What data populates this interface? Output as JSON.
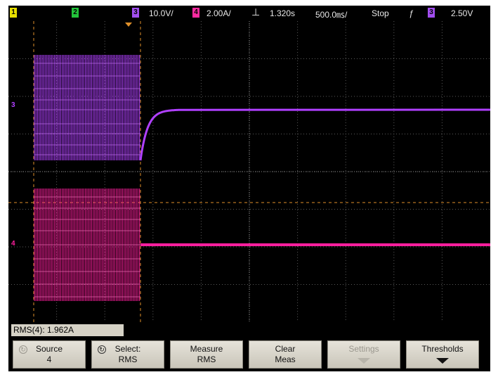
{
  "status_bar": {
    "channels": [
      {
        "number": "1",
        "color": "#e8e000"
      },
      {
        "number": "2",
        "color": "#22c43a"
      },
      {
        "number": "3",
        "color": "#a24ef0"
      },
      {
        "number": "4",
        "color": "#ff2aa0"
      }
    ],
    "ch3_scale": "10.0V/",
    "ch4_scale": "2.00A/",
    "trigger_delay": "1.320s",
    "timebase": "500.0㎳/",
    "run_state": "Stop",
    "trigger_edge": "ƒ",
    "trigger_source": "3",
    "trigger_level": "2.50V"
  },
  "measurement": {
    "readout": "RMS(4): 1.962A"
  },
  "softkeys": {
    "source": {
      "line1": "Source",
      "line2": "4"
    },
    "select": {
      "line1": "Select:",
      "line2": "RMS"
    },
    "measure": {
      "line1": "Measure",
      "line2": "RMS"
    },
    "clear": {
      "line1": "Clear",
      "line2": "Meas"
    },
    "settings": {
      "line1": "Settings"
    },
    "thresholds": {
      "line1": "Thresholds"
    }
  },
  "channel_markers": {
    "ch3": "3",
    "ch4": "4"
  },
  "colors": {
    "ch3_trace": "#b040ff",
    "ch4_trace": "#ff1f9e",
    "grid": "#5a5a5a",
    "cursor": "#e0902a"
  }
}
